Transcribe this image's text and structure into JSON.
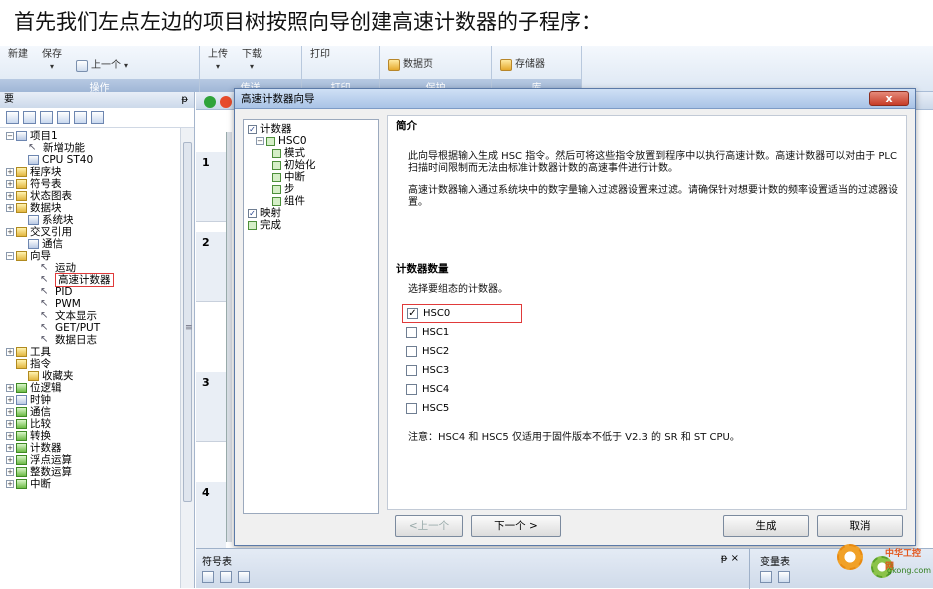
{
  "caption": "首先我们左点左边的项目树按照向导创建高速计数器的子程序：",
  "ribbon": {
    "groups": [
      {
        "label": "操作",
        "buttons": [
          "新建",
          "保存",
          "上一个"
        ]
      },
      {
        "label": "传送",
        "buttons": [
          "上传",
          "下载"
        ]
      },
      {
        "label": "打印",
        "buttons": [
          "打印"
        ]
      },
      {
        "label": "保护",
        "buttons": [
          "数据页"
        ]
      },
      {
        "label": "库",
        "buttons": [
          "存储器"
        ]
      }
    ]
  },
  "tree": {
    "header": "要",
    "pin": "ᵽ",
    "items": [
      {
        "text": "项目1",
        "indent": 0,
        "exp": "⊟",
        "icon": "b"
      },
      {
        "text": "新增功能",
        "indent": 1,
        "exp": "",
        "icon": "w"
      },
      {
        "text": "CPU ST40",
        "indent": 1,
        "exp": "",
        "icon": "b"
      },
      {
        "text": "程序块",
        "indent": 0,
        "exp": "⊞",
        "icon": "y"
      },
      {
        "text": "符号表",
        "indent": 0,
        "exp": "⊞",
        "icon": "y"
      },
      {
        "text": "状态图表",
        "indent": 0,
        "exp": "⊞",
        "icon": "y"
      },
      {
        "text": "数据块",
        "indent": 0,
        "exp": "⊞",
        "icon": "y"
      },
      {
        "text": "系统块",
        "indent": 1,
        "exp": "",
        "icon": "b"
      },
      {
        "text": "交叉引用",
        "indent": 0,
        "exp": "⊞",
        "icon": "y"
      },
      {
        "text": "通信",
        "indent": 1,
        "exp": "",
        "icon": "b"
      },
      {
        "text": "向导",
        "indent": 0,
        "exp": "⊟",
        "icon": "y"
      },
      {
        "text": "运动",
        "indent": 2,
        "exp": "",
        "icon": "w"
      },
      {
        "text": "高速计数器",
        "indent": 2,
        "exp": "",
        "icon": "w",
        "highlight": true
      },
      {
        "text": "PID",
        "indent": 2,
        "exp": "",
        "icon": "w"
      },
      {
        "text": "PWM",
        "indent": 2,
        "exp": "",
        "icon": "w"
      },
      {
        "text": "文本显示",
        "indent": 2,
        "exp": "",
        "icon": "w"
      },
      {
        "text": "GET/PUT",
        "indent": 2,
        "exp": "",
        "icon": "w"
      },
      {
        "text": "数据日志",
        "indent": 2,
        "exp": "",
        "icon": "w"
      },
      {
        "text": "工具",
        "indent": 0,
        "exp": "⊞",
        "icon": "y"
      },
      {
        "text": "指令",
        "indent": 0,
        "exp": "",
        "icon": "y"
      },
      {
        "text": "收藏夹",
        "indent": 1,
        "exp": "",
        "icon": "y"
      },
      {
        "text": "位逻辑",
        "indent": 0,
        "exp": "⊞",
        "icon": "g"
      },
      {
        "text": "时钟",
        "indent": 0,
        "exp": "⊞",
        "icon": "b"
      },
      {
        "text": "通信",
        "indent": 0,
        "exp": "⊞",
        "icon": "g"
      },
      {
        "text": "比较",
        "indent": 0,
        "exp": "⊞",
        "icon": "g"
      },
      {
        "text": "转换",
        "indent": 0,
        "exp": "⊞",
        "icon": "g"
      },
      {
        "text": "计数器",
        "indent": 0,
        "exp": "⊞",
        "icon": "g"
      },
      {
        "text": "浮点运算",
        "indent": 0,
        "exp": "⊞",
        "icon": "g"
      },
      {
        "text": "整数运算",
        "indent": 0,
        "exp": "⊞",
        "icon": "g"
      },
      {
        "text": "中断",
        "indent": 0,
        "exp": "⊞",
        "icon": "g"
      }
    ]
  },
  "editor": {
    "rungs": [
      "1",
      "2",
      "3",
      "4"
    ]
  },
  "dialog": {
    "title": "高速计数器向导",
    "close": "x",
    "nav": [
      {
        "text": "计数器",
        "indent": 0,
        "box": "check"
      },
      {
        "text": "HSC0",
        "indent": 1,
        "box": "green",
        "exp": "⊟"
      },
      {
        "text": "模式",
        "indent": 3,
        "box": "green"
      },
      {
        "text": "初始化",
        "indent": 3,
        "box": "green"
      },
      {
        "text": "中断",
        "indent": 3,
        "box": "green"
      },
      {
        "text": "步",
        "indent": 3,
        "box": "green"
      },
      {
        "text": "组件",
        "indent": 3,
        "box": "green"
      },
      {
        "text": "映射",
        "indent": 0,
        "box": "check"
      },
      {
        "text": "完成",
        "indent": 0,
        "box": "green"
      }
    ],
    "intro_heading": "简介",
    "intro_p1": "此向导根据输入生成 HSC 指令。然后可将这些指令放置到程序中以执行高速计数。高速计数器可以对由于 PLC 扫描时间限制而无法由标准计数器计数的高速事件进行计数。",
    "intro_p2": "高速计数器输入通过系统块中的数字量输入过滤器设置来过滤。请确保针对想要计数的频率设置适当的过滤器设置。",
    "count_heading": "计数器数量",
    "count_prompt": "选择要组态的计数器。",
    "counters": [
      {
        "label": "HSC0",
        "checked": true
      },
      {
        "label": "HSC1",
        "checked": false
      },
      {
        "label": "HSC2",
        "checked": false
      },
      {
        "label": "HSC3",
        "checked": false
      },
      {
        "label": "HSC4",
        "checked": false
      },
      {
        "label": "HSC5",
        "checked": false
      }
    ],
    "note": "注意：HSC4 和 HSC5 仅适用于固件版本不低于 V2.3 的 SR 和 ST CPU。",
    "btn_prev": "<上一个",
    "btn_next": "下一个 >",
    "btn_generate": "生成",
    "btn_cancel": "取消"
  },
  "bottom": {
    "symbol_table": "符号表",
    "symbol_pin": "ᵽ ×",
    "watch_table": "变量表",
    "watermark_title": "中华工控网",
    "watermark_url": "gkong.com"
  },
  "colors": {
    "highlight": "#e03a3a",
    "ribbon": "#dde7f3"
  }
}
